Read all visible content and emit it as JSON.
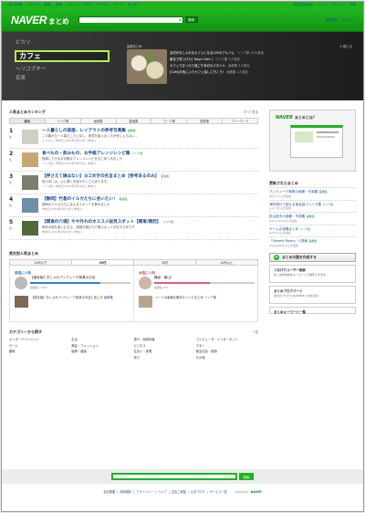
{
  "topnav": {
    "items": [
      "総合検索",
      "トピック",
      "動画",
      "画像",
      "ウェブ",
      "ブログ",
      "クチコミ",
      "マーク",
      "まとめ"
    ],
    "right": [
      "言語変換設定",
      "ヘルプ",
      "ログイン",
      "お問"
    ]
  },
  "header": {
    "logo_naver": "NAVER",
    "logo_matome": "まとめ",
    "search_button": "検索",
    "user_links": [
      "新規登録",
      "ログイン"
    ]
  },
  "hero": {
    "keywords": [
      "ピカソ",
      "カフェ",
      "ヘリコプター",
      "花見"
    ],
    "featured_label": "話題まとめ",
    "close": "× 閉じる",
    "items": [
      {
        "title": "自宅がおしゃれなカフェになる105のアルバム",
        "meta": "リンク集 15人参加"
      },
      {
        "title": "東京で見つけた[ Tokyo Cafe ]",
        "meta": "リンク集 1人参加"
      },
      {
        "title": "カフェでまったり過ごす休日のスタイル",
        "meta": "画像集 3人参加"
      },
      {
        "title": "[Cafe]お気に入りカフェ探しに行こう!",
        "meta": "画像集 1人参加"
      }
    ]
  },
  "ranking": {
    "title": "人気まとめランキング",
    "more": "すべて見る",
    "tabs": [
      "総合",
      "リンク集",
      "画像集",
      "動画集",
      "ワード集",
      "推薦集",
      "フリーワード"
    ],
    "items": [
      {
        "rank": "1",
        "change": "位",
        "title": "一人暮らしの部屋、レイアウトの参考写真集",
        "tag": "画像集",
        "desc": "この春から一人暮らしで上京し、家具を揃えましたが気に入らない...",
        "meta": "ふうさん | 作成日:2010年4月21日 | 参加:3"
      },
      {
        "rank": "2",
        "change": "位",
        "title": "食べもの・飲みもの、お手軽アレンジレシピ集",
        "tag": "リンク集",
        "desc": "簡単にできるお手軽なアレンジレシピをまとめてみました",
        "meta": "リンク集 | 作成日:2010年4月22日 | 参加:4"
      },
      {
        "rank": "3",
        "change": "位",
        "title": "【押さえて損はない】ヨコ文字の名言まとめ【参考あるのみ】",
        "tag": "名言集",
        "desc": "世の中には、心に響く名言がたくさんあります。",
        "meta": "リンク集 | 作成日:2010年4月19日 | 参加:2"
      },
      {
        "rank": "4",
        "change": "位",
        "title": "【静岡】竹島のイルカたちに会いたい！",
        "tag": "動画集",
        "desc": "静岡のイルカたちに会えるスポットを集めました",
        "meta": "作成日:2010年4月16日 | 参加:2"
      },
      {
        "rank": "5",
        "change": "位",
        "title": "【関東の穴場】やや外れのオススメ桜見スポット【関東/関西】",
        "tag": "リンク集",
        "desc": "毎年の桜を楽しむなら、混雑を避けた穴場スポットがおすすめです",
        "meta": "作成日:2010年4月20日 | 参加:1"
      }
    ]
  },
  "gender": {
    "title": "男女別人気まとめ",
    "tabs": [
      "10代以下",
      "20代",
      "30代",
      "40代以上"
    ],
    "male": {
      "label": "男性に人気",
      "title": "【保存版】おしゃれアンティーク家具のお店",
      "tag": "画像集",
      "count": "1,024",
      "sub_title": "【保存版】おしゃれアンティーク家具のお店と探し方",
      "sub_tag": "画像集"
    },
    "female": {
      "label": "女性に人気",
      "title": "鎌倉・葉山！",
      "tag": "画像集",
      "count": "870",
      "sub_title": "ハートの画像を集めたリンクまとめ",
      "sub_tag": "リンク集"
    }
  },
  "categories": {
    "title": "カテゴリーから探す",
    "more": "一覧",
    "items": [
      "エンターテインメント",
      "生活",
      "旅行・地域情報",
      "コンピュータ・インターネット",
      "ゲーム",
      "美容・ファッション",
      "ビジネス",
      "マネー",
      "趣味",
      "医療・健康",
      "住まい・家電",
      "政治社会・経済",
      "",
      "",
      "学び",
      "その他"
    ]
  },
  "sidebar": {
    "promo_logo": "NAVER",
    "promo_text": "まとめとは？",
    "updated_title": "更新されたまとめ",
    "updated": [
      {
        "title": "アンティーク家具の画像・写真集",
        "tag": "画像集",
        "meta": "ゆかりさんが追加"
      },
      {
        "title": "海外旅行で使える英会話フレーズ集",
        "tag": "リンク集",
        "meta": "シルカさんが追加"
      },
      {
        "title": "松山英夫の画像・写真集",
        "tag": "画像集",
        "meta": "lovecombiさんが追加"
      },
      {
        "title": "ゲームの攻略まとめ",
        "tag": "リンク集",
        "meta": "kumaさんが追加"
      },
      {
        "title": "「Sweets Room」と検索",
        "tag": "画像集",
        "meta": "lovesweetsさんが追加"
      }
    ],
    "make_button": "まとめの題を作成する",
    "feat1_title": "つなげりユーザー検索",
    "feat1_desc": "まとめ作成者をキーワードで検索できます",
    "feat2_title": "まとめブログパーツ",
    "feat2_desc": "自分のブログにNAVERまとめを表示",
    "feat3_title": "まとめキーワード一覧"
  },
  "footer": {
    "search_button": "検索",
    "links": [
      "会社概要",
      "利用規約",
      "プライバシー",
      "ヘルプ",
      "広告ご掲載",
      "公式ブログ",
      "サービス一覧"
    ],
    "copyright": "Copyright",
    "brand": "NAVER"
  }
}
